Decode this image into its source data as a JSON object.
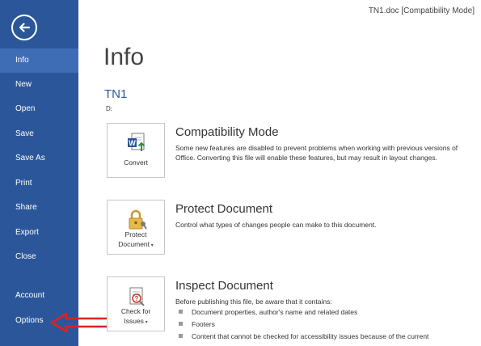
{
  "window": {
    "title": "TN1.doc [Compatibility Mode]"
  },
  "sidebar": {
    "back_icon": "back-arrow-icon",
    "items": [
      {
        "label": "Info"
      },
      {
        "label": "New"
      },
      {
        "label": "Open"
      },
      {
        "label": "Save"
      },
      {
        "label": "Save As"
      },
      {
        "label": "Print"
      },
      {
        "label": "Share"
      },
      {
        "label": "Export"
      },
      {
        "label": "Close"
      },
      {
        "label": "Account"
      },
      {
        "label": "Options"
      }
    ],
    "active": "Info"
  },
  "main": {
    "heading": "Info",
    "doc_name": "TN1",
    "doc_path": "D:",
    "sections": [
      {
        "button_label": "Convert",
        "icon": "word-convert-icon",
        "title": "Compatibility Mode",
        "description": "Some new features are disabled to prevent problems when working with previous versions of Office. Converting this file will enable these features, but may result in layout changes."
      },
      {
        "button_label_1": "Protect",
        "button_label_2": "Document",
        "icon": "lock-key-icon",
        "title": "Protect Document",
        "description": "Control what types of changes people can make to this document."
      },
      {
        "button_label_1": "Check for",
        "button_label_2": "Issues",
        "icon": "inspect-document-icon",
        "title": "Inspect Document",
        "description": "Before publishing this file, be aware that it contains:",
        "bullets": [
          "Document properties, author's name and related dates",
          "Footers",
          "Content that cannot be checked for accessibility issues because of the current"
        ]
      }
    ]
  },
  "colors": {
    "sidebar": "#2b579a",
    "active_item": "#3e6db5",
    "accent": "#2b579a",
    "arrow": "#e02020"
  }
}
